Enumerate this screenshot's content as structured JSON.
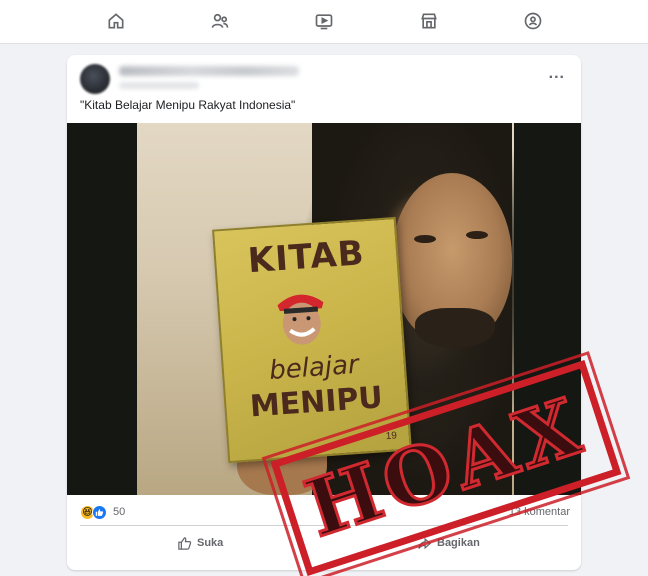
{
  "nav": {
    "icons": [
      "home-icon",
      "friends-icon",
      "video-icon",
      "marketplace-icon",
      "groups-icon"
    ]
  },
  "post": {
    "caption": "\"Kitab Belajar Menipu Rakyat Indonesia\"",
    "more": "...",
    "image": {
      "book_title_line1": "KITAB",
      "book_title_line2": "belajar",
      "book_title_line3": "MENIPU",
      "book_number": "19"
    },
    "reactions": {
      "count": "50",
      "emojis": [
        "haha-icon",
        "like-icon"
      ]
    },
    "comments": "13 komentar",
    "actions": {
      "like_label": "Suka",
      "share_label": "Bagikan"
    }
  },
  "stamp": {
    "text": "HOAX",
    "color": "#cc1f27"
  },
  "colors": {
    "background": "#f0f2f5",
    "card": "#ffffff",
    "secondary_text": "#65676b"
  }
}
